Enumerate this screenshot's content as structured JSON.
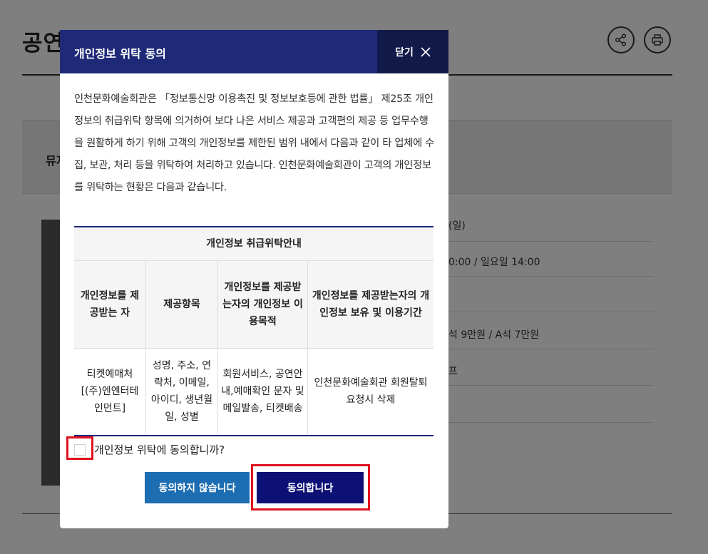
{
  "background": {
    "title": "공연안내",
    "band_text": "뮤지컬",
    "info_lines": [
      "(일)",
      "0:00 / 일요일 14:00",
      "석 9만원 / A석 7만원",
      "프"
    ]
  },
  "modal": {
    "title": "개인정보 위탁 동의",
    "close_label": "닫기",
    "intro": "인천문화예술회관은 「정보통신망 이용촉진 및 정보보호등에 관한 법률」 제25조 개인정보의 취급위탁 항목에 의거하여 보다 나은 서비스 제공과 고객편의 제공 등 업무수행을 원활하게 하기 위해 고객의 개인정보를 제한된 범위 내에서 다음과 같이 타 업체에 수집, 보관, 처리 등을 위탁하여 처리하고 있습니다. 인천문화예술회관이 고객의 개인정보를 위탁하는 현황은 다음과 같습니다.",
    "table": {
      "caption": "개인정보 취급위탁안내",
      "headers": [
        "개인정보를 제공받는 자",
        "제공항목",
        "개인정보를 제공받는자의 개인정보 이용목적",
        "개인정보를 제공받는자의 개인정보 보유 및 이용기간"
      ],
      "row": [
        "티켓예매처 [(주)엔엔터테인먼트]",
        "성명, 주소, 연락처, 이메일, 아이디, 생년월일, 성별",
        "회원서비스, 공연안내,예매확인 문자 및 메일발송, 티켓배송",
        "인천문화예술회관 회원탈퇴 요청시 삭제"
      ]
    },
    "agree_question": "개인정보 위탁에 동의합니까?",
    "agree_checked": false,
    "disagree_button": "동의하지 않습니다",
    "agree_button": "동의합니다"
  },
  "colors": {
    "header": "#1e2a78",
    "close_bg": "#121a4a",
    "disagree_btn": "#1c6db2",
    "agree_btn": "#0d1175",
    "highlight": "#e0121f"
  },
  "icons": [
    "share-icon",
    "print-icon",
    "close-icon"
  ]
}
